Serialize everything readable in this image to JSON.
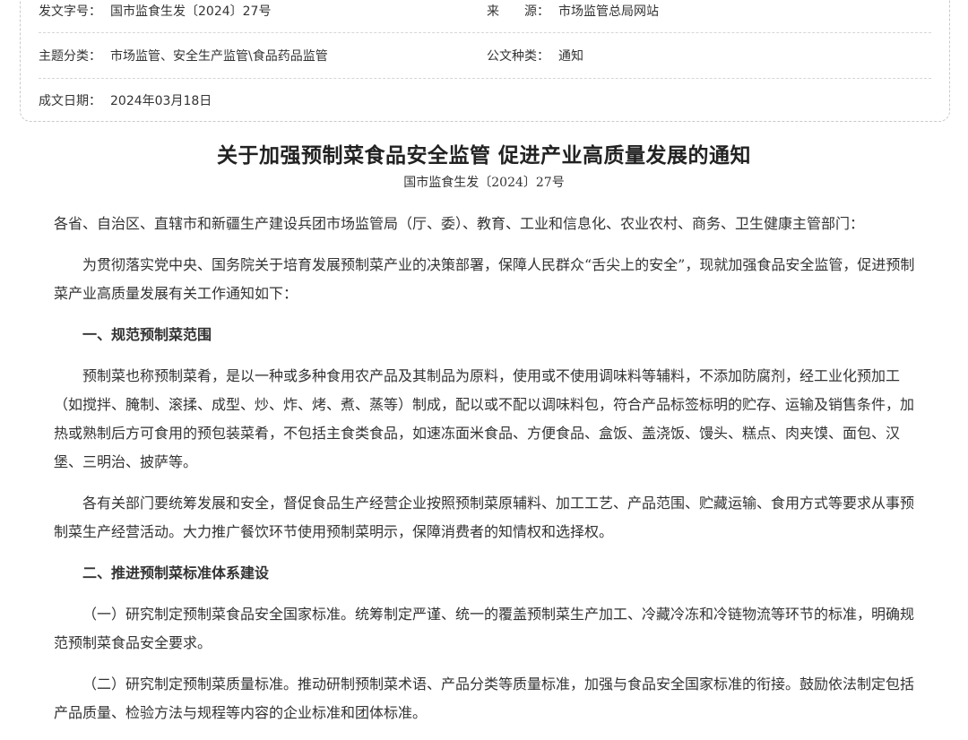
{
  "meta": {
    "doc_number_label": "发文字号：",
    "doc_number_value": "国市监食生发〔2024〕27号",
    "source_label": "来　　源：",
    "source_value": "市场监管总局网站",
    "topic_label": "主题分类：",
    "topic_value": "市场监管、安全生产监管\\食品药品监管",
    "doc_type_label": "公文种类：",
    "doc_type_value": "通知",
    "date_label": "成文日期：",
    "date_value": "2024年03月18日"
  },
  "article": {
    "title": "关于加强预制菜食品安全监管 促进产业高质量发展的通知",
    "doc_number": "国市监食生发〔2024〕27号",
    "salutation": "各省、自治区、直辖市和新疆生产建设兵团市场监管局（厅、委）、教育、工业和信息化、农业农村、商务、卫生健康主管部门：",
    "intro": "为贯彻落实党中央、国务院关于培育发展预制菜产业的决策部署，保障人民群众“舌尖上的安全”，现就加强食品安全监管，促进预制菜产业高质量发展有关工作通知如下：",
    "section1_heading": "一、规范预制菜范围",
    "section1_para1": "预制菜也称预制菜肴，是以一种或多种食用农产品及其制品为原料，使用或不使用调味料等辅料，不添加防腐剂，经工业化预加工（如搅拌、腌制、滚揉、成型、炒、炸、烤、煮、蒸等）制成，配以或不配以调味料包，符合产品标签标明的贮存、运输及销售条件，加热或熟制后方可食用的预包装菜肴，不包括主食类食品，如速冻面米食品、方便食品、盒饭、盖浇饭、馒头、糕点、肉夹馍、面包、汉堡、三明治、披萨等。",
    "section1_para2": "各有关部门要统筹发展和安全，督促食品生产经营企业按照预制菜原辅料、加工工艺、产品范围、贮藏运输、食用方式等要求从事预制菜生产经营活动。大力推广餐饮环节使用预制菜明示，保障消费者的知情权和选择权。",
    "section2_heading": "二、推进预制菜标准体系建设",
    "section2_item1": "（一）研究制定预制菜食品安全国家标准。统筹制定严谨、统一的覆盖预制菜生产加工、冷藏冷冻和冷链物流等环节的标准，明确规范预制菜食品安全要求。",
    "section2_item2": "（二）研究制定预制菜质量标准。推动研制预制菜术语、产品分类等质量标准，加强与食品安全国家标准的衔接。鼓励依法制定包括产品质量、检验方法与规程等内容的企业标准和团体标准。"
  }
}
